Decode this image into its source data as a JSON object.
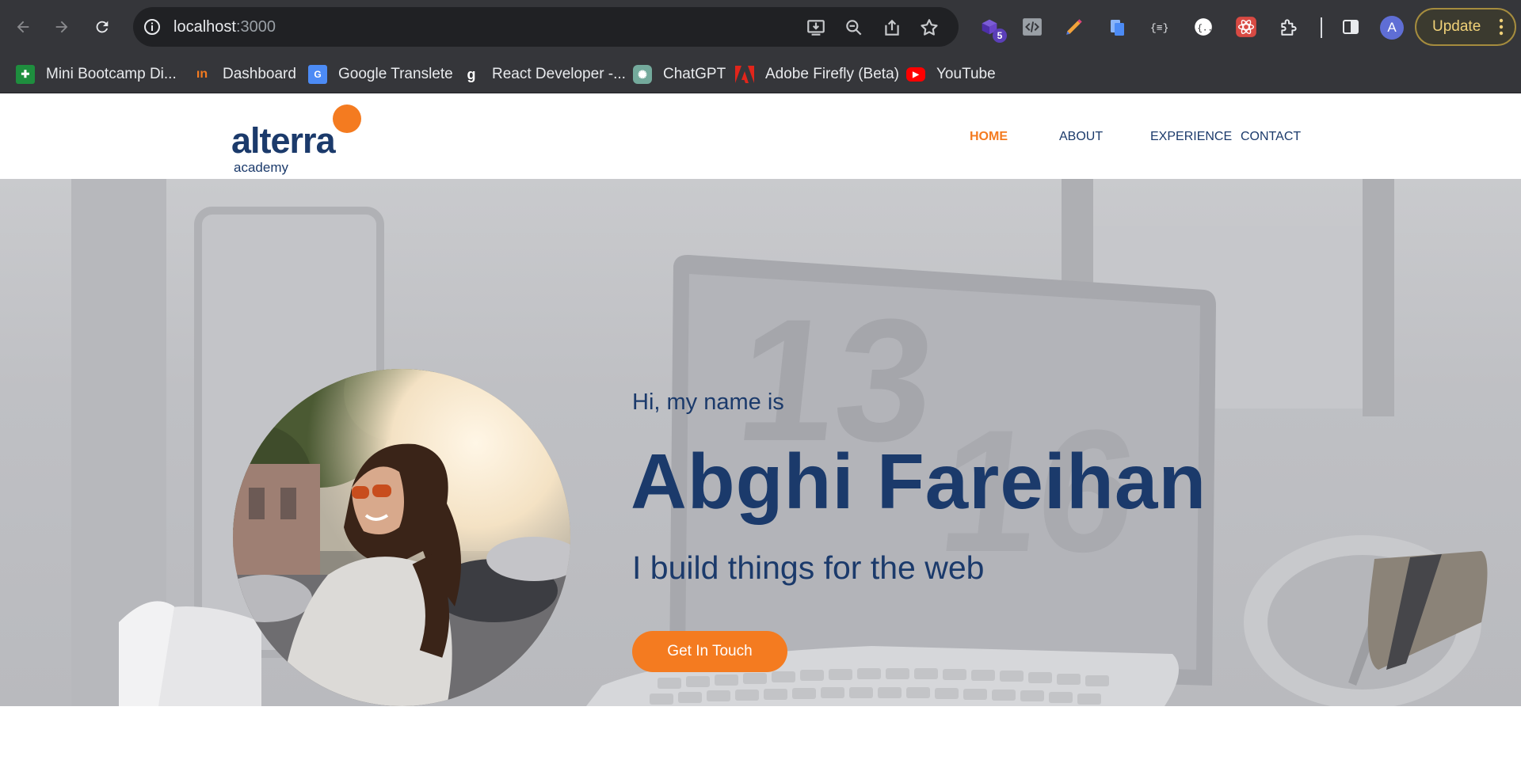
{
  "browser": {
    "url_host": "localhost",
    "url_port": ":3000",
    "extension_badge": "5",
    "profile_initial": "A",
    "update_label": "Update",
    "bookmarks": [
      {
        "label": "Mini Bootcamp Di...",
        "icon": "google-sheets-icon"
      },
      {
        "label": "Dashboard",
        "icon": "dashboard-icon"
      },
      {
        "label": "Google Translete",
        "icon": "google-translate-icon"
      },
      {
        "label": "React Developer -...",
        "icon": "react-developer-icon"
      },
      {
        "label": "ChatGPT",
        "icon": "chatgpt-icon"
      },
      {
        "label": "Adobe Firefly (Beta)",
        "icon": "adobe-icon"
      },
      {
        "label": "YouTube",
        "icon": "youtube-icon"
      }
    ]
  },
  "site": {
    "logo_word": "alterra",
    "logo_sub": "academy",
    "menu": [
      "HOME",
      "ABOUT",
      "EXPERIENCE",
      "CONTACT"
    ],
    "active_menu": "HOME",
    "accent": "#f47b20",
    "primary": "#1b3a6b"
  },
  "hero": {
    "greeting": "Hi, my name is",
    "name": "Abghi Fareihan",
    "tagline": "I build things for the web",
    "cta_label": "Get In Touch"
  }
}
